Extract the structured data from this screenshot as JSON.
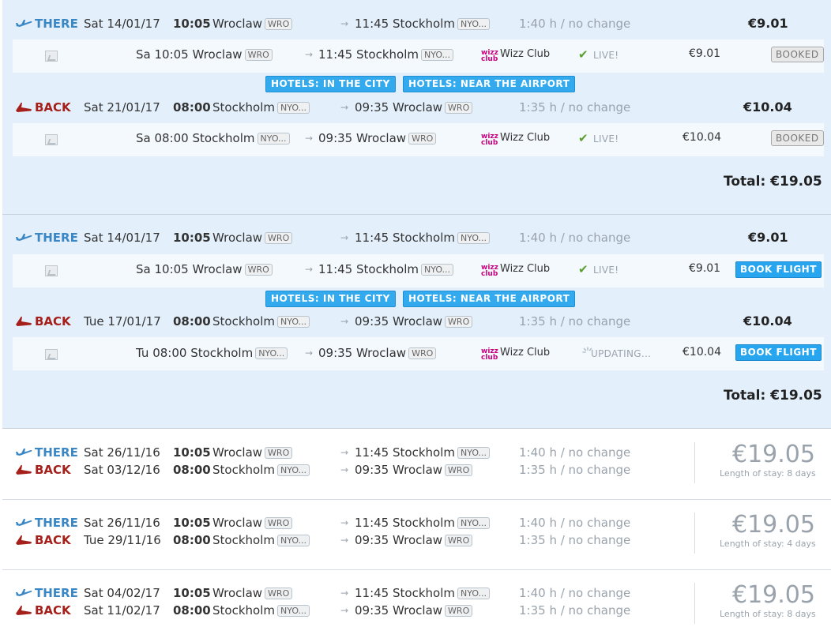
{
  "groups": [
    {
      "there": {
        "label": "THERE",
        "date": "Sat 14/01/17",
        "time": "10:05",
        "from": "Wroclaw",
        "from_code": "WRO",
        "arr_time": "11:45",
        "to": "Stockholm",
        "to_code": "NYO...",
        "duration": "1:40 h / no change",
        "price": "€9.01"
      },
      "there_sub": {
        "day": "Sa",
        "time": "10:05",
        "from": "Wroclaw",
        "from_code": "WRO",
        "arr_time": "11:45",
        "to": "Stockholm",
        "to_code": "NYO...",
        "carrier": "Wizz Club",
        "status": "LIVE!",
        "price": "€9.01",
        "action": "BOOKED"
      },
      "back": {
        "label": "BACK",
        "date": "Sat 21/01/17",
        "time": "08:00",
        "from": "Stockholm",
        "from_code": "NYO...",
        "arr_time": "09:35",
        "to": "Wroclaw",
        "to_code": "WRO",
        "duration": "1:35 h / no change",
        "price": "€10.04"
      },
      "back_sub": {
        "day": "Sa",
        "time": "08:00",
        "from": "Stockholm",
        "from_code": "NYO...",
        "arr_time": "09:35",
        "to": "Wroclaw",
        "to_code": "WRO",
        "carrier": "Wizz Club",
        "status": "LIVE!",
        "price": "€10.04",
        "action": "BOOKED"
      },
      "total": "Total: €19.05"
    },
    {
      "there": {
        "label": "THERE",
        "date": "Sat 14/01/17",
        "time": "10:05",
        "from": "Wroclaw",
        "from_code": "WRO",
        "arr_time": "11:45",
        "to": "Stockholm",
        "to_code": "NYO...",
        "duration": "1:40 h / no change",
        "price": "€9.01"
      },
      "there_sub": {
        "day": "Sa",
        "time": "10:05",
        "from": "Wroclaw",
        "from_code": "WRO",
        "arr_time": "11:45",
        "to": "Stockholm",
        "to_code": "NYO...",
        "carrier": "Wizz Club",
        "status": "LIVE!",
        "price": "€9.01",
        "action": "BOOK FLIGHT"
      },
      "back": {
        "label": "BACK",
        "date": "Tue 17/01/17",
        "time": "08:00",
        "from": "Stockholm",
        "from_code": "NYO...",
        "arr_time": "09:35",
        "to": "Wroclaw",
        "to_code": "WRO",
        "duration": "1:35 h / no change",
        "price": "€10.04"
      },
      "back_sub": {
        "day": "Tu",
        "time": "08:00",
        "from": "Stockholm",
        "from_code": "NYO...",
        "arr_time": "09:35",
        "to": "Wroclaw",
        "to_code": "WRO",
        "carrier": "Wizz Club",
        "status": "UPDATING...",
        "price": "€10.04",
        "action": "BOOK FLIGHT"
      },
      "total": "Total: €19.05"
    }
  ],
  "hotels": {
    "city": "HOTELS: IN THE CITY",
    "airport": "HOTELS: NEAR THE AIRPORT"
  },
  "carrier_logo": {
    "line1": "wizz",
    "line2": "club"
  },
  "results": [
    {
      "there": {
        "label": "THERE",
        "date": "Sat 26/11/16",
        "time": "10:05",
        "from": "Wroclaw",
        "from_code": "WRO",
        "arr_time": "11:45",
        "to": "Stockholm",
        "to_code": "NYO...",
        "duration": "1:40 h / no change"
      },
      "back": {
        "label": "BACK",
        "date": "Sat 03/12/16",
        "time": "08:00",
        "from": "Stockholm",
        "from_code": "NYO...",
        "arr_time": "09:35",
        "to": "Wroclaw",
        "to_code": "WRO",
        "duration": "1:35 h / no change"
      },
      "price": "€19.05",
      "stay": "Length of stay: 8 days"
    },
    {
      "there": {
        "label": "THERE",
        "date": "Sat 26/11/16",
        "time": "10:05",
        "from": "Wroclaw",
        "from_code": "WRO",
        "arr_time": "11:45",
        "to": "Stockholm",
        "to_code": "NYO...",
        "duration": "1:40 h / no change"
      },
      "back": {
        "label": "BACK",
        "date": "Tue 29/11/16",
        "time": "08:00",
        "from": "Stockholm",
        "from_code": "NYO...",
        "arr_time": "09:35",
        "to": "Wroclaw",
        "to_code": "WRO",
        "duration": "1:35 h / no change"
      },
      "price": "€19.05",
      "stay": "Length of stay: 4 days"
    },
    {
      "there": {
        "label": "THERE",
        "date": "Sat 04/02/17",
        "time": "10:05",
        "from": "Wroclaw",
        "from_code": "WRO",
        "arr_time": "11:45",
        "to": "Stockholm",
        "to_code": "NYO...",
        "duration": "1:40 h / no change"
      },
      "back": {
        "label": "BACK",
        "date": "Sat 11/02/17",
        "time": "08:00",
        "from": "Stockholm",
        "from_code": "NYO...",
        "arr_time": "09:35",
        "to": "Wroclaw",
        "to_code": "WRO",
        "duration": "1:35 h / no change"
      },
      "price": "€19.05",
      "stay": "Length of stay: 8 days"
    }
  ],
  "colors": {
    "there": "#3b87c4",
    "back": "#a5201b",
    "panel": "#e3f0fc",
    "button": "#27a6ef"
  },
  "icons": {
    "there": "plane-takeoff-icon",
    "back": "plane-landing-icon",
    "arrow": "arrow-right-icon",
    "check": "check-icon",
    "spinner": "spinner-icon",
    "thumb": "image-placeholder-icon"
  }
}
